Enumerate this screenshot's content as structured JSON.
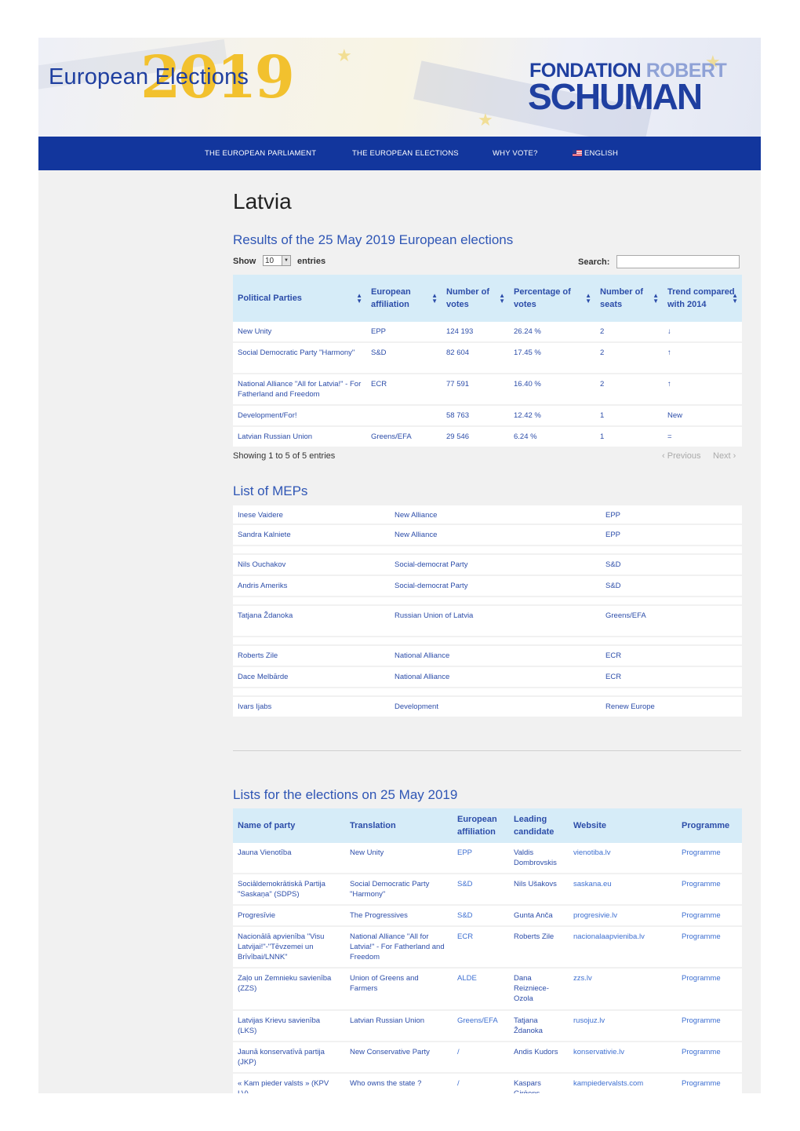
{
  "header": {
    "title": "European Elections",
    "year": "2019",
    "brand_line1_dark": "FONDATION",
    "brand_line1_light": "ROBERT",
    "brand_line2": "SCHUMAN"
  },
  "nav": {
    "items": [
      "THE EUROPEAN PARLIAMENT",
      "THE EUROPEAN ELECTIONS",
      "WHY VOTE?"
    ],
    "language": "ENGLISH",
    "language_icon": "us-flag-icon"
  },
  "page": {
    "title": "Latvia"
  },
  "results": {
    "heading": "Results of the 25 May 2019 European elections",
    "show_label": "Show",
    "entries_value": "10",
    "entries_label": "entries",
    "search_label": "Search:",
    "search_value": "",
    "columns": [
      "Political Parties",
      "European affiliation",
      "Number of votes",
      "Percentage of votes",
      "Number of seats",
      "Trend compared with 2014"
    ],
    "rows": [
      [
        "New Unity",
        "EPP",
        "124 193",
        "26.24 %",
        "2",
        "↓"
      ],
      [
        "Social Democratic Party \"Harmony\"",
        "S&D",
        "82 604",
        "17.45 %",
        "2",
        "↑"
      ],
      [
        "National Alliance \"All for Latvia!\" - For Fatherland and Freedom",
        "ECR",
        "77 591",
        "16.40 %",
        "2",
        "↑"
      ],
      [
        "Development/For!",
        "",
        "58 763",
        "12.42 %",
        "1",
        "New"
      ],
      [
        "Latvian Russian Union",
        "Greens/EFA",
        "29 546",
        "6.24 %",
        "1",
        "="
      ]
    ],
    "info": "Showing 1 to 5 of 5 entries",
    "previous": "Previous",
    "next": "Next"
  },
  "meps": {
    "heading": "List of MEPs",
    "rows": [
      [
        "Inese Vaidere",
        "New Alliance",
        "EPP"
      ],
      [
        "Sandra Kalniete",
        "New Alliance",
        "EPP"
      ],
      [
        "Nils Ouchakov",
        "Social-democrat Party",
        "S&D"
      ],
      [
        "Andris Ameriks",
        "Social-democrat Party",
        "S&D"
      ],
      [
        "Tatjana Ždanoka",
        "Russian Union of Latvia",
        "Greens/EFA"
      ],
      [
        "Roberts Zile",
        "National Alliance",
        "ECR"
      ],
      [
        "Dace Melbārde",
        "National Alliance",
        "ECR"
      ],
      [
        "Ivars Ijabs",
        "Development",
        "Renew Europe"
      ]
    ]
  },
  "lists": {
    "heading": "Lists for the elections on 25 May 2019",
    "columns": [
      "Name of party",
      "Translation",
      "European affiliation",
      "Leading candidate",
      "Website",
      "Programme"
    ],
    "rows": [
      [
        "Jauna Vienotība",
        "New Unity",
        "EPP",
        "Valdis Dombrovskis",
        "vienotiba.lv",
        "Programme"
      ],
      [
        "Sociāldemokrātiskā Partija \"Saskaņa\" (SDPS)",
        "Social Democratic Party \"Harmony\"",
        "S&D",
        "Nils Ušakovs",
        "saskana.eu",
        "Programme"
      ],
      [
        "Progresīvie",
        "The Progressives",
        "S&D",
        "Gunta Anča",
        "progresivie.lv",
        "Programme"
      ],
      [
        "Nacionālā apvienība \"Visu Latvijai!\"-\"Tēvzemei un Brīvībai/LNNK\"",
        "National Alliance \"All for Latvia!\" - For Fatherland and Freedom",
        "ECR",
        "Roberts Zile",
        "nacionalaapvieniba.lv",
        "Programme"
      ],
      [
        "Zaļo un Zemnieku savienība (ZZS)",
        "Union of Greens and Farmers",
        "ALDE",
        "Dana Reizniece-Ozola",
        "zzs.lv",
        "Programme"
      ],
      [
        "Latvijas Krievu savienība (LKS)",
        "Latvian Russian Union",
        "Greens/EFA",
        "Tatjana Ždanoka",
        "rusojuz.lv",
        "Programme"
      ],
      [
        "Jaunā konservatīvā partija (JKP)",
        "New Conservative Party",
        "/",
        "Andis Kudors",
        "konservativie.lv",
        "Programme"
      ],
      [
        "« Kam pieder valsts » (KPV LV)",
        "Who owns the state ?",
        "/",
        "Kaspars Ģirģens",
        "kampiedervalsts.com",
        "Programme"
      ]
    ]
  },
  "colors": {
    "nav_bg": "#12369d",
    "title_blue": "#1f3fa0",
    "year_yellow": "#f2c12e",
    "header_row_bg": "#d6ecf8",
    "link_blue": "#2c4da9"
  }
}
